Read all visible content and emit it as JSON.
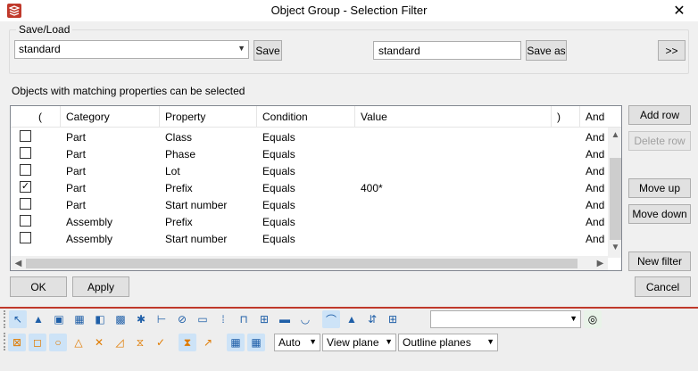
{
  "window": {
    "title": "Object Group - Selection Filter",
    "close_glyph": "✕"
  },
  "saveload": {
    "legend": "Save/Load",
    "preset_select_value": "standard",
    "save_label": "Save",
    "save_as_name_value": "standard",
    "save_as_label": "Save as",
    "expand_label": ">>"
  },
  "hint": "Objects with matching properties can be selected",
  "table": {
    "columns": [
      "(",
      "Category",
      "Property",
      "Condition",
      "Value",
      ")",
      "And"
    ],
    "rows": [
      {
        "checked": false,
        "open": "",
        "category": "Part",
        "property": "Class",
        "condition": "Equals",
        "value": "",
        "close": "",
        "and": "And"
      },
      {
        "checked": false,
        "open": "",
        "category": "Part",
        "property": "Phase",
        "condition": "Equals",
        "value": "",
        "close": "",
        "and": "And"
      },
      {
        "checked": false,
        "open": "",
        "category": "Part",
        "property": "Lot",
        "condition": "Equals",
        "value": "",
        "close": "",
        "and": "And"
      },
      {
        "checked": true,
        "open": "",
        "category": "Part",
        "property": "Prefix",
        "condition": "Equals",
        "value": "400*",
        "close": "",
        "and": "And"
      },
      {
        "checked": false,
        "open": "",
        "category": "Part",
        "property": "Start number",
        "condition": "Equals",
        "value": "",
        "close": "",
        "and": "And"
      },
      {
        "checked": false,
        "open": "",
        "category": "Assembly",
        "property": "Prefix",
        "condition": "Equals",
        "value": "",
        "close": "",
        "and": "And"
      },
      {
        "checked": false,
        "open": "",
        "category": "Assembly",
        "property": "Start number",
        "condition": "Equals",
        "value": "",
        "close": "",
        "and": "And"
      }
    ]
  },
  "side_buttons": {
    "add_row": "Add row",
    "delete_row": "Delete row",
    "move_up": "Move up",
    "move_down": "Move down",
    "new_filter": "New filter"
  },
  "footer": {
    "ok": "OK",
    "apply": "Apply",
    "cancel": "Cancel"
  },
  "toolbar": {
    "row1_icons": [
      "select-all-icon",
      "select-part-icon",
      "select-surface-icon",
      "select-component-icon",
      "select-component-object-icon",
      "select-grid-icon",
      "select-grid-line-icon",
      "select-weld-icon",
      "select-cut-icon",
      "select-view-icon",
      "select-points-icon",
      "select-reinforcement-icon",
      "select-bolt-group-icon",
      "select-single-bolt-icon",
      "select-pour-icon",
      "select-assembly-icon",
      "select-object-in-assembly-icon",
      "select-component-in-component-icon",
      "select-assembly-in-assembly-icon",
      "select-filter-options-icon"
    ],
    "filter_select_value": "",
    "row2_icons": [
      "snap-end-point-icon",
      "snap-center-icon",
      "snap-midpoint-icon",
      "snap-intersection-icon",
      "snap-perpendicular-icon",
      "snap-line-extension-icon",
      "snap-any-position-icon",
      "snap-nearest-icon",
      "snap-override-icon",
      "snap-extension-icon",
      "snap-reference-lines-icon",
      "snap-geometry-lines-icon"
    ],
    "depth_select_value": "Auto",
    "plane_select_value": "View plane",
    "planes_display_value": "Outline planes"
  }
}
